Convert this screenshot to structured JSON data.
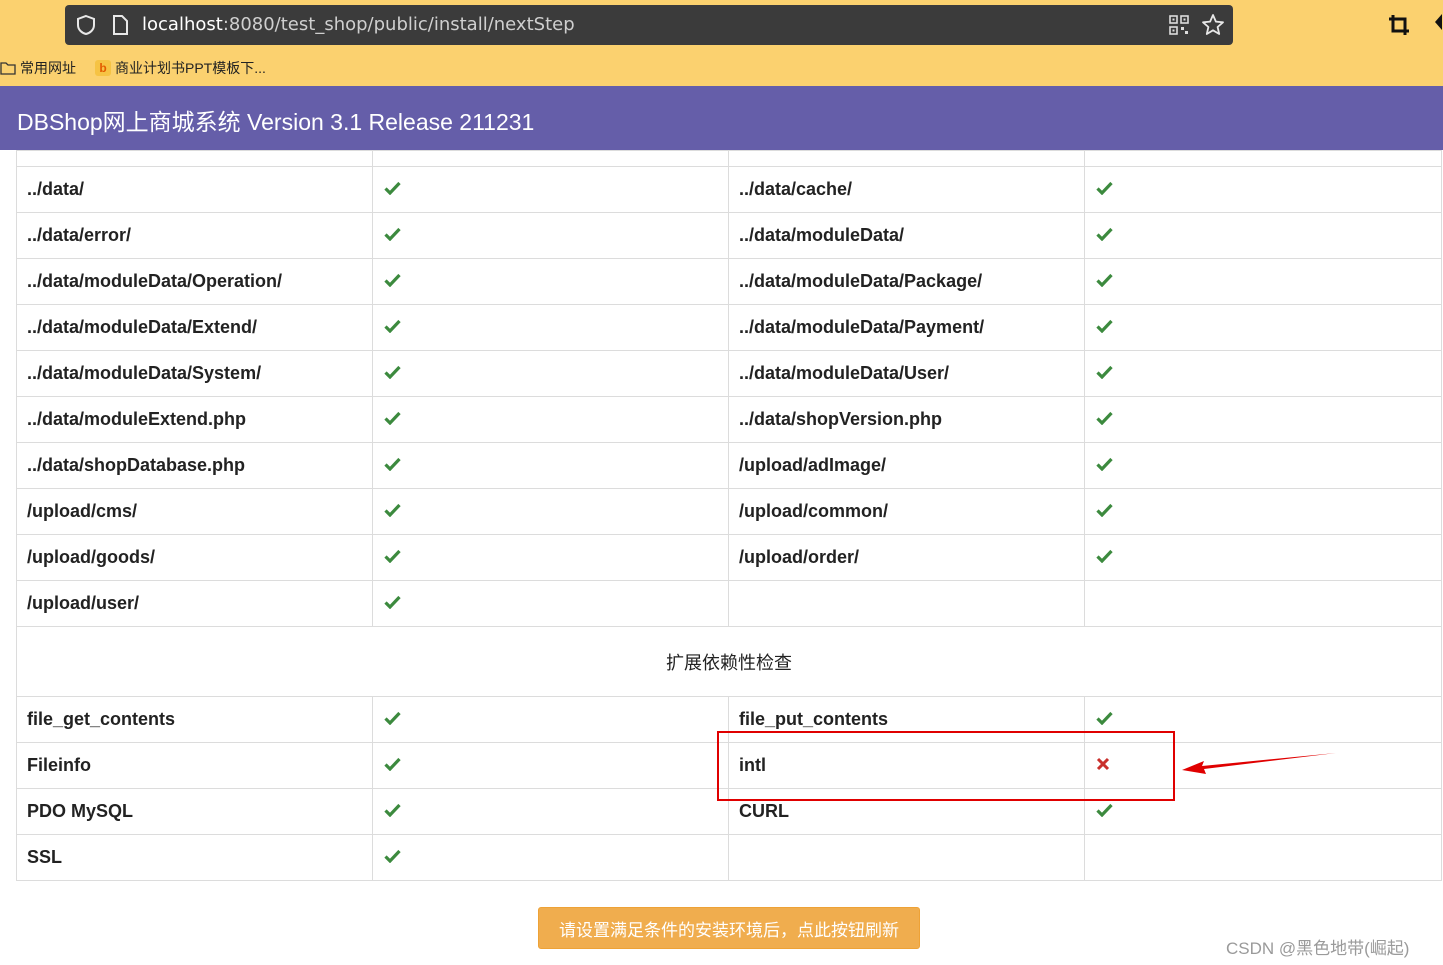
{
  "browser": {
    "url_host": "localhost",
    "url_rest": ":8080/test_shop/public/install/nextStep",
    "bookmarks": [
      "常用网址",
      "商业计划书PPT模板下..."
    ]
  },
  "header": {
    "title": "DBShop网上商城系统 Version 3.1 Release 211231"
  },
  "dir_rows": [
    [
      "../data/",
      "ok",
      "../data/cache/",
      "ok"
    ],
    [
      "../data/error/",
      "ok",
      "../data/moduleData/",
      "ok"
    ],
    [
      "../data/moduleData/Operation/",
      "ok",
      "../data/moduleData/Package/",
      "ok"
    ],
    [
      "../data/moduleData/Extend/",
      "ok",
      "../data/moduleData/Payment/",
      "ok"
    ],
    [
      "../data/moduleData/System/",
      "ok",
      "../data/moduleData/User/",
      "ok"
    ],
    [
      "../data/moduleExtend.php",
      "ok",
      "../data/shopVersion.php",
      "ok"
    ],
    [
      "../data/shopDatabase.php",
      "ok",
      "/upload/adImage/",
      "ok"
    ],
    [
      "/upload/cms/",
      "ok",
      "/upload/common/",
      "ok"
    ],
    [
      "/upload/goods/",
      "ok",
      "/upload/order/",
      "ok"
    ],
    [
      "/upload/user/",
      "ok",
      "",
      ""
    ]
  ],
  "section_title": "扩展依赖性检查",
  "ext_rows": [
    [
      "file_get_contents",
      "ok",
      "file_put_contents",
      "ok"
    ],
    [
      "Fileinfo",
      "ok",
      "intl",
      "fail"
    ],
    [
      "PDO MySQL",
      "ok",
      "CURL",
      "ok"
    ],
    [
      "SSL",
      "ok",
      "",
      ""
    ]
  ],
  "refresh_button": "请设置满足条件的安装环境后，点此按钮刷新",
  "watermark": "CSDN @黑色地带(崛起)",
  "colors": {
    "header": "#655ea9",
    "ok": "#3c8a3e",
    "fail": "#c9302c",
    "button": "#f0ad4e",
    "highlight": "#e00000"
  }
}
